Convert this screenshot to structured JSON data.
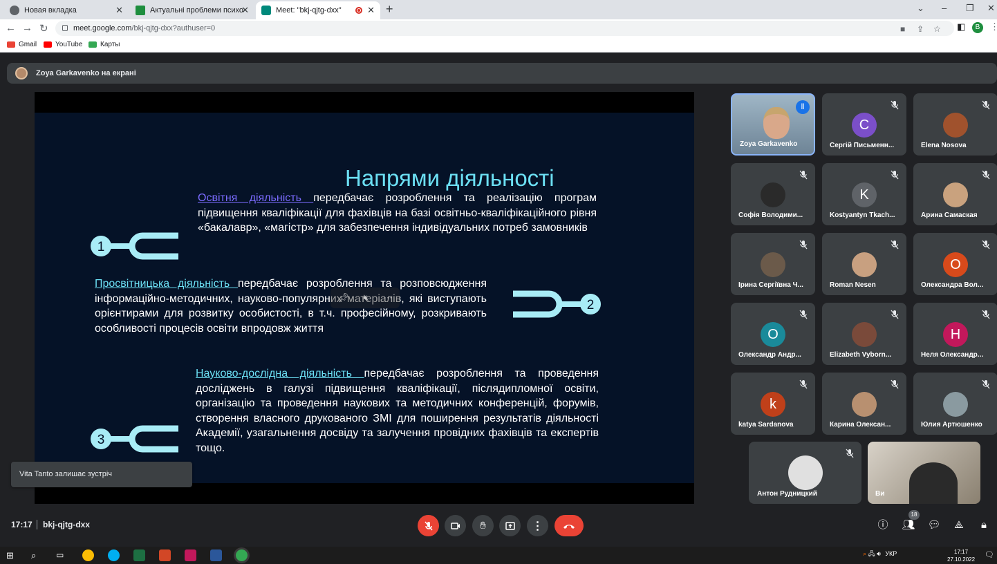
{
  "browser": {
    "tabs": [
      {
        "label": "Новая вкладка",
        "active": false
      },
      {
        "label": "Актуальні проблеми психології",
        "active": false
      },
      {
        "label": "Meet: \"bkj-qjtg-dxx\"",
        "active": true
      }
    ],
    "url_domain": "meet.google.com",
    "url_path": "/bkj-qjtg-dxx?authuser=0",
    "profile_initial": "B",
    "bookmarks": [
      "Gmail",
      "YouTube",
      "Карты"
    ]
  },
  "presentation": {
    "banner": "Zoya Garkavenko на екрані"
  },
  "slide": {
    "title": "Напрями діяльності",
    "items": [
      {
        "number": "1",
        "link": "Освітня діяльність ",
        "text": "передбачає розроблення та реалізацію програм підвищення кваліфікації для фахівців на базі освітньо-кваліфікаційного рівня «бакалавр», «магістр» для забезпечення індивідуальних потреб замовників"
      },
      {
        "number": "2",
        "link": "Просвітницька діяльність ",
        "text": "передбачає розроблення та розповсюдження інформаційно-методичних, науково-популярних матеріалів, які виступають орієнтирами для розвитку особистості, в т.ч. професійному, розкривають особливості процесів освіти впродовж життя"
      },
      {
        "number": "3",
        "link": "Науково-дослідна діяльність ",
        "text": "передбачає розроблення та проведення досліджень в галузі підвищення кваліфікації, післядипломної освіти, організацію та проведення наукових та методичних конференцій, форумів, створення власного друкованого ЗМІ для поширення результатів діяльності Академії, узагальнення досвіду та залучення провідних фахівців та експертів тощо."
      }
    ]
  },
  "toast": "Vita Tanto залишає зустріч",
  "participants": [
    {
      "name": "Zoya Garkavenko",
      "initial": "",
      "color": "",
      "photo": true,
      "speaking": true
    },
    {
      "name": "Сергій Письменн...",
      "initial": "С",
      "color": "#7b4fc9",
      "photo": false
    },
    {
      "name": "Elena Nosova",
      "initial": "",
      "color": "#a0522d",
      "photo": true
    },
    {
      "name": "Софія Володими...",
      "initial": "",
      "color": "#2a2a2a",
      "photo": true
    },
    {
      "name": "Kostyantyn Tkach...",
      "initial": "K",
      "color": "#5f6368",
      "photo": false
    },
    {
      "name": "Арина Самаская",
      "initial": "",
      "color": "#c9a27e",
      "photo": true
    },
    {
      "name": "Ірина Сергіївна Ч...",
      "initial": "",
      "color": "#6b5a4a",
      "photo": true
    },
    {
      "name": "Roman Nesen",
      "initial": "",
      "color": "#c8a080",
      "photo": true
    },
    {
      "name": "Олександра Вол...",
      "initial": "O",
      "color": "#d84a1b",
      "photo": false
    },
    {
      "name": "Олександр Андр...",
      "initial": "O",
      "color": "#1a8a9a",
      "photo": false
    },
    {
      "name": "Elizabeth Vyborn...",
      "initial": "",
      "color": "#7a4a3a",
      "photo": true
    },
    {
      "name": "Неля Олександр...",
      "initial": "Н",
      "color": "#c2185b",
      "photo": false
    },
    {
      "name": "katya Sardanova",
      "initial": "k",
      "color": "#c0401a",
      "photo": false
    },
    {
      "name": "Карина Олексан...",
      "initial": "",
      "color": "#b89070",
      "photo": true
    },
    {
      "name": "Юлия Артюшенко",
      "initial": "",
      "color": "#8a9aa0",
      "photo": true
    },
    {
      "name": "Антон Рудницкий",
      "initial": "",
      "color": "#e0e0e0",
      "photo": true
    },
    {
      "name": "Ви",
      "initial": "",
      "color": "#c8c0b0",
      "photo": true
    }
  ],
  "meeting": {
    "time": "17:17",
    "code": "bkj-qjtg-dxx",
    "participant_count": "18"
  },
  "taskbar": {
    "lang": "УКР",
    "time": "17:17",
    "date": "27.10.2022"
  },
  "colors": {
    "accent_cyan": "#6ce0f4",
    "link_violet": "#7b6bff",
    "end_call_red": "#ea4335"
  }
}
